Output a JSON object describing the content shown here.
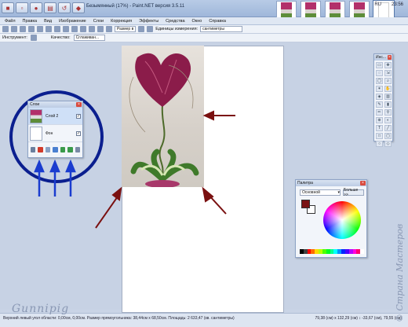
{
  "window": {
    "title": "Безымянный (17%) - Paint.NET версия 3.5.11",
    "tray_lang": "RU",
    "clock": "23:56",
    "thumb_count": 5
  },
  "menu": [
    "Файл",
    "Правка",
    "Вид",
    "Изображение",
    "Слои",
    "Коррекция",
    "Эффекты",
    "Средства",
    "Окно",
    "Справка"
  ],
  "toolbar": {
    "size_label": "Размер в",
    "units_label": "Единицы измерения:",
    "units_value": "сантиметры"
  },
  "options_bar": {
    "tool_label": "Инструмент:",
    "quality_label": "Качество:",
    "quality_value": "Сглаживан..."
  },
  "layers_panel": {
    "title": "Слои",
    "layers": [
      {
        "name": "Слой 2",
        "visible": true,
        "selected": true
      },
      {
        "name": "Фон",
        "visible": true,
        "selected": false
      }
    ]
  },
  "tools_panel": {
    "title": "Инс..."
  },
  "palette": {
    "title": "Палитра",
    "mode": "Основной",
    "more_button": "Больше >>",
    "primary_color": "#7a1414",
    "secondary_color": "#ffffff",
    "swatch_colors": [
      "#000000",
      "#404040",
      "#ff0000",
      "#ff6a00",
      "#ffd800",
      "#b6ff00",
      "#4cff00",
      "#00ff21",
      "#00ff90",
      "#00ffff",
      "#0094ff",
      "#0026ff",
      "#4800ff",
      "#b200ff",
      "#ff00dc",
      "#ff006e",
      "#ffffff"
    ]
  },
  "status": {
    "left": "Верхний левый угол области: 0,00см, 0,00см. Размер прямоугольника: 38,44см x 68,50см. Площадь: 2 633,47 (кв. сантиметры)",
    "right": "79,38 (см) x 132,29 (см)  ↕ -33,67 (см), 79,55 (см)"
  },
  "watermark_signature": "Gunnipig",
  "watermark_site": "© Страна Мастеров",
  "annotation_color": "#7a1010",
  "circle_color": "#0b1f8f"
}
